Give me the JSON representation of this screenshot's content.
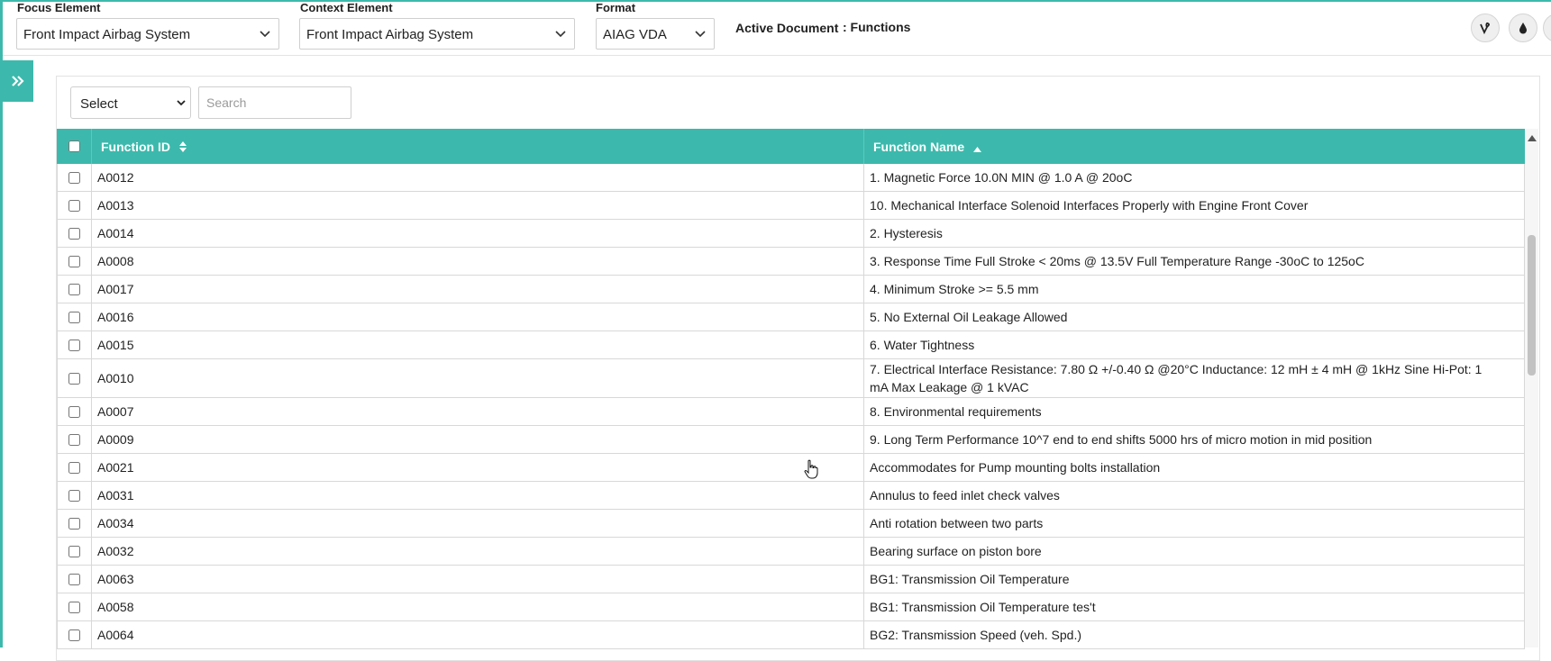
{
  "header": {
    "focus_label": "Focus Element",
    "focus_value": "Front Impact Airbag System",
    "context_label": "Context Element",
    "context_value": "Front Impact Airbag System",
    "format_label": "Format",
    "format_value": "AIAG VDA",
    "active_doc_label": "Active Document",
    "active_doc_value": ": Functions",
    "icons": [
      "vine-icon",
      "drop-icon",
      "more-icon"
    ]
  },
  "toolbar": {
    "select_value": "Select",
    "search_placeholder": "Search"
  },
  "table": {
    "columns": [
      "Function ID",
      "Function Name"
    ],
    "sort": {
      "column": "Function Name",
      "direction": "ascending"
    },
    "rows": [
      {
        "id": "A0012",
        "name": "1. Magnetic Force 10.0N MIN @ 1.0 A @ 20oC"
      },
      {
        "id": "A0013",
        "name": "10. Mechanical Interface Solenoid Interfaces Properly with Engine Front Cover"
      },
      {
        "id": "A0014",
        "name": "2. Hysteresis"
      },
      {
        "id": "A0008",
        "name": "3. Response Time Full Stroke < 20ms @ 13.5V Full Temperature Range -30oC to 125oC"
      },
      {
        "id": "A0017",
        "name": "4. Minimum Stroke >= 5.5 mm"
      },
      {
        "id": "A0016",
        "name": "5. No External Oil Leakage Allowed"
      },
      {
        "id": "A0015",
        "name": "6. Water Tightness"
      },
      {
        "id": "A0010",
        "name": "7. Electrical Interface Resistance: 7.80 Ω +/-0.40 Ω @20°C Inductance: 12 mH ± 4 mH @ 1kHz Sine Hi-Pot: 1 mA Max Leakage @ 1 kVAC"
      },
      {
        "id": "A0007",
        "name": "8. Environmental requirements"
      },
      {
        "id": "A0009",
        "name": "9. Long Term Performance 10^7 end to end shifts 5000 hrs of micro motion in mid position"
      },
      {
        "id": "A0021",
        "name": "Accommodates for Pump mounting bolts installation"
      },
      {
        "id": "A0031",
        "name": "Annulus to feed inlet check valves"
      },
      {
        "id": "A0034",
        "name": "Anti rotation between two parts"
      },
      {
        "id": "A0032",
        "name": "Bearing surface on piston bore"
      },
      {
        "id": "A0063",
        "name": "BG1: Transmission Oil Temperature"
      },
      {
        "id": "A0058",
        "name": "BG1: Transmission Oil Temperature tes't"
      },
      {
        "id": "A0064",
        "name": "BG2: Transmission Speed (veh. Spd.)"
      }
    ]
  },
  "colors": {
    "accent": "#3cb9ac",
    "header_text": "#ffffff"
  }
}
